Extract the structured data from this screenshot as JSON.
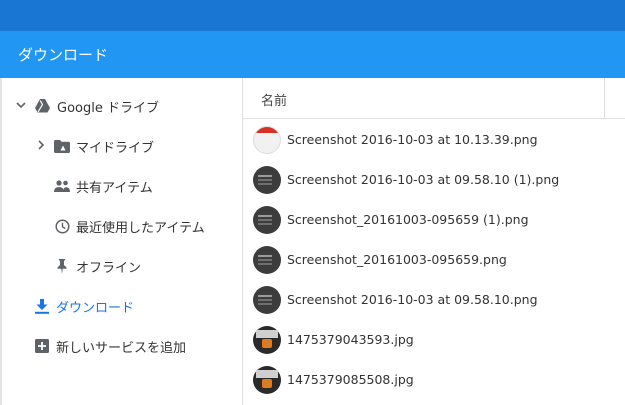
{
  "window": {
    "title": "ダウンロード"
  },
  "sidebar": {
    "items": [
      {
        "label": "Google ドライブ",
        "icon": "google-drive-icon",
        "expander": "chevron-down-icon"
      },
      {
        "label": "マイドライブ",
        "icon": "folder-drive-icon",
        "expander": "chevron-right-icon"
      },
      {
        "label": "共有アイテム",
        "icon": "people-icon"
      },
      {
        "label": "最近使用したアイテム",
        "icon": "clock-icon"
      },
      {
        "label": "オフライン",
        "icon": "pin-icon"
      },
      {
        "label": "ダウンロード",
        "icon": "download-icon",
        "active": true
      },
      {
        "label": "新しいサービスを追加",
        "icon": "add-box-icon"
      }
    ]
  },
  "filelist": {
    "column_name": "名前",
    "files": [
      {
        "name": "Screenshot 2016-10-03 at 10.13.39.png",
        "thumb": "screenshot-light"
      },
      {
        "name": "Screenshot 2016-10-03 at 09.58.10 (1).png",
        "thumb": "screenshot-dark"
      },
      {
        "name": "Screenshot_20161003-095659 (1).png",
        "thumb": "screenshot-dark"
      },
      {
        "name": "Screenshot_20161003-095659.png",
        "thumb": "screenshot-dark"
      },
      {
        "name": "Screenshot 2016-10-03 at 09.58.10.png",
        "thumb": "screenshot-dark"
      },
      {
        "name": "1475379043593.jpg",
        "thumb": "photo"
      },
      {
        "name": "1475379085508.jpg",
        "thumb": "photo"
      }
    ]
  },
  "colors": {
    "top_strip": "#1976d2",
    "titlebar": "#2196f3",
    "active_item": "#1a73e8",
    "icon_gray": "#5f6368"
  }
}
